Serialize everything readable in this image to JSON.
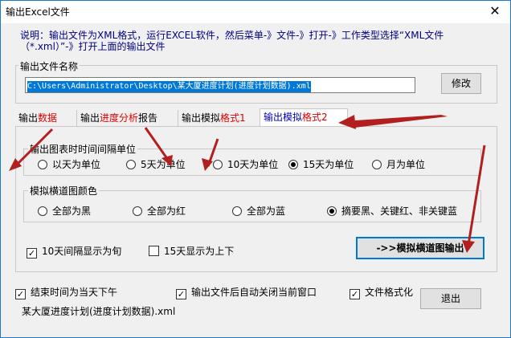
{
  "window": {
    "title": "输出Excel文件",
    "close_glyph": "✕"
  },
  "description": "说明：输出文件为XML格式，运行EXCEL软件，然后菜单-》文件-》打开-》工作类型选择“XML文件（*.xml）”-》打开上面的输出文件",
  "output_group": {
    "label": "输出文件名称",
    "path": "C:\\Users\\Administrator\\Desktop\\某大厦进度计划(进度计划数据).xml",
    "modify_label": "修改"
  },
  "tabs": [
    {
      "parts": [
        "输出",
        "数据"
      ]
    },
    {
      "parts": [
        "输出",
        "进度分析",
        "报告"
      ]
    },
    {
      "parts": [
        "输出模拟",
        "格式1"
      ]
    },
    {
      "parts": [
        "输出模拟",
        "格式2"
      ]
    }
  ],
  "interval_group": {
    "label": "输出图表时时间间隔单位",
    "options": [
      "以天为单位",
      "5天为单位",
      "10天为单位",
      "15天为单位",
      "月为单位"
    ],
    "selected_index": 3
  },
  "color_group": {
    "label": "模拟横道图颜色",
    "options": [
      "全部为黑",
      "全部为红",
      "全部为蓝",
      "摘要黑、关键红、非关键蓝"
    ],
    "selected_index": 3
  },
  "tab_checks": [
    {
      "label": "10天间隔显示为旬",
      "checked": true
    },
    {
      "label": "15天显示为上下",
      "checked": false
    }
  ],
  "export_button_label": "->>模拟横道图输出",
  "bottom_checks": [
    {
      "label": "结束时间为当天下午",
      "checked": true
    },
    {
      "label": "输出文件后自动关闭当前窗口",
      "checked": true
    },
    {
      "label": "文件格式化",
      "checked": true
    }
  ],
  "exit_label": "退出",
  "footer_filename": "某大厦进度计划(进度计划数据).xml",
  "colors": {
    "accent": "#0078d7",
    "highlight_red": "#e00000",
    "arrow": "#b21f1f",
    "desc_blue": "#000080"
  }
}
